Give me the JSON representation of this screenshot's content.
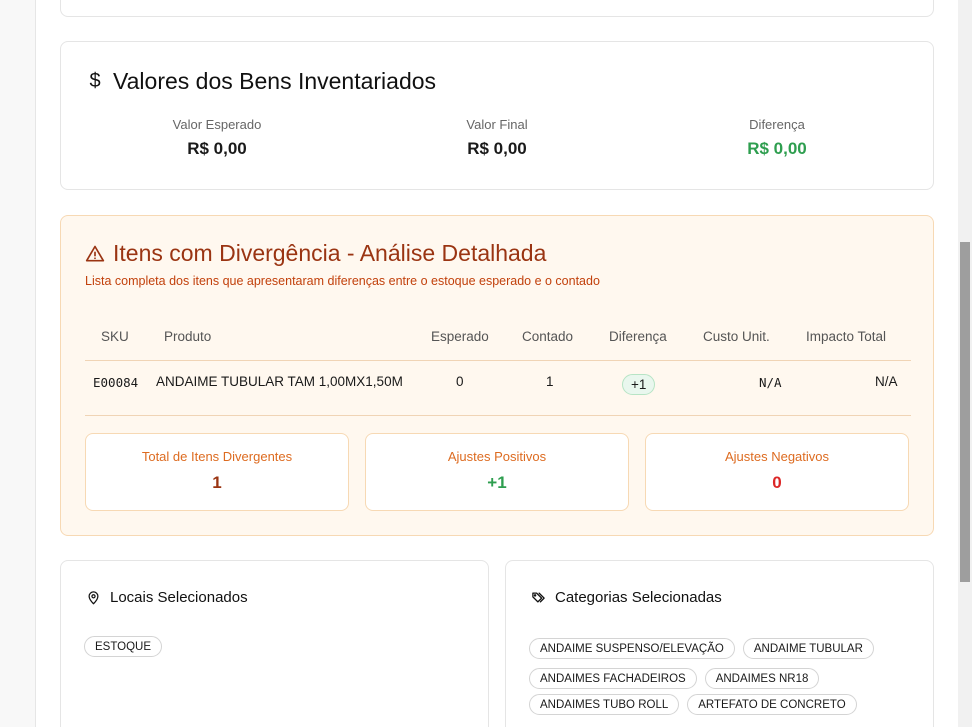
{
  "values_section": {
    "title": "Valores dos Bens Inventariados",
    "icon": "dollar-icon",
    "columns": [
      {
        "label": "Valor Esperado",
        "amount": "R$ 0,00"
      },
      {
        "label": "Valor Final",
        "amount": "R$ 0,00"
      },
      {
        "label": "Diferença",
        "amount": "R$ 0,00"
      }
    ]
  },
  "divergence": {
    "title": "Itens com Divergência - Análise Detalhada",
    "subtitle": "Lista completa dos itens que apresentaram diferenças entre o estoque esperado e o contado",
    "headers": [
      "SKU",
      "Produto",
      "Esperado",
      "Contado",
      "Diferença",
      "Custo Unit.",
      "Impacto Total"
    ],
    "rows": [
      {
        "sku": "E00084",
        "product": "ANDAIME TUBULAR TAM 1,00MX1,50M",
        "expected": "0",
        "counted": "1",
        "difference": "+1",
        "unit_cost": "N/A",
        "total_impact": "N/A"
      }
    ],
    "stats": [
      {
        "label": "Total de Itens Divergentes",
        "value": "1"
      },
      {
        "label": "Ajustes Positivos",
        "value": "+1"
      },
      {
        "label": "Ajustes Negativos",
        "value": "0"
      }
    ]
  },
  "locations": {
    "title": "Locais Selecionados",
    "items": [
      "ESTOQUE"
    ]
  },
  "categories": {
    "title": "Categorias Selecionadas",
    "items": [
      "ANDAIME SUSPENSO/ELEVAÇÃO",
      "ANDAIME TUBULAR",
      "ANDAIMES FACHADEIROS",
      "ANDAIMES NR18",
      "ANDAIMES TUBO ROLL",
      "ARTEFATO DE CONCRETO"
    ]
  },
  "colors": {
    "warning_title": "#9a3412",
    "positive": "#2e9e4f",
    "negative": "#dc2626",
    "warning_bg": "#fff8ef"
  }
}
